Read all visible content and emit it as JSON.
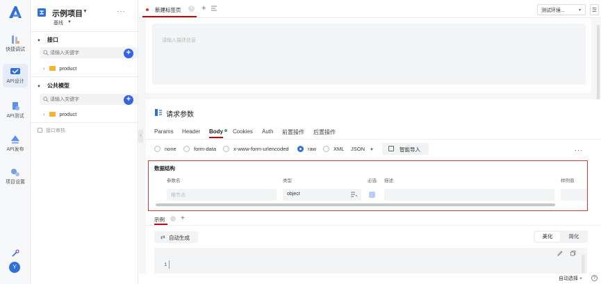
{
  "rail": {
    "items": [
      {
        "label": "快捷调试",
        "icon": "quick-debug-icon"
      },
      {
        "label": "API设计",
        "icon": "api-design-icon"
      },
      {
        "label": "API测试",
        "icon": "api-test-icon"
      },
      {
        "label": "API发布",
        "icon": "api-publish-icon"
      },
      {
        "label": "项目设置",
        "icon": "project-settings-icon"
      }
    ],
    "avatar_initial": "Y"
  },
  "project": {
    "title": "示例项目",
    "branch": "基线",
    "more": "···",
    "sections": [
      {
        "title": "接口",
        "search_placeholder": "请输入关键字",
        "items": [
          "product"
        ]
      },
      {
        "title": "公共模型",
        "search_placeholder": "请输入关键字",
        "items": [
          "product"
        ]
      }
    ],
    "review_label": "接口审核"
  },
  "tabs": {
    "active_tab": "新建标签页",
    "add": "+",
    "env_label": "测试环境...",
    "env_caret": "▾"
  },
  "description": {
    "placeholder": "请输入描述信息"
  },
  "request": {
    "title": "请求参数",
    "subtabs": [
      "Params",
      "Header",
      "Body",
      "Cookies",
      "Auth",
      "前置操作",
      "后置操作"
    ],
    "active_subtab": "Body",
    "body_types": [
      "none",
      "form-data",
      "x-www-form-urlencoded",
      "raw",
      "XML"
    ],
    "selected_body_type": "raw",
    "format": "JSON",
    "smart_import": "智能导入",
    "more": "···"
  },
  "schema": {
    "title": "数据结构",
    "columns": [
      "参数名",
      "类型",
      "必选",
      "描述",
      "样例值"
    ],
    "row": {
      "name_placeholder": "根节点",
      "type": "object",
      "required": true
    }
  },
  "example": {
    "tab_label": "示例",
    "add": "+",
    "autogen": "自动生成",
    "modes": [
      "美化",
      "简化"
    ],
    "active_mode": "美化",
    "line_number": "1"
  },
  "status": {
    "auto_select": "自动选择",
    "plus": "+",
    "help": "?"
  },
  "colors": {
    "accent": "#2f6fd6",
    "active_tab_border": "#cc0000",
    "highlight_frame": "#d63333",
    "folder": "#f6b32d"
  }
}
